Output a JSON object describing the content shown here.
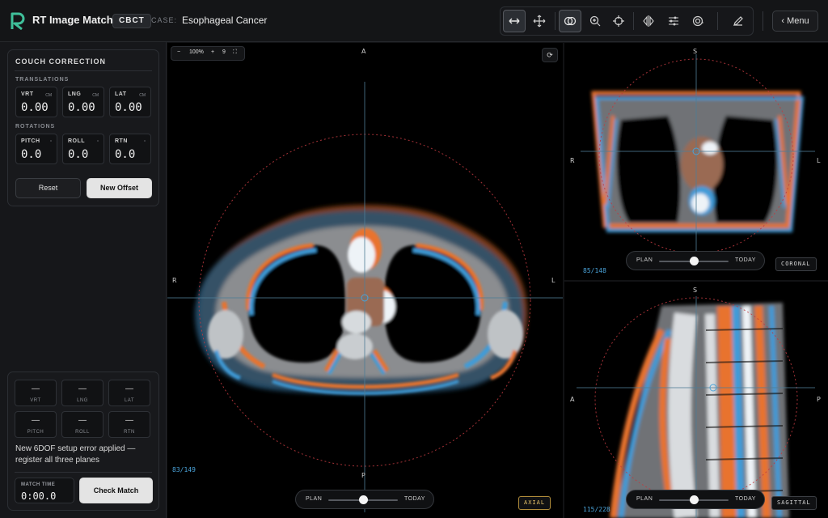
{
  "header": {
    "app_title": "RT Image Match",
    "modality_badge": "CBCT",
    "case_label": "CASE:",
    "case_name": "Esophageal Cancer",
    "menu_label": "‹ Menu",
    "tools": [
      {
        "name": "horizontal-move-icon",
        "active": true
      },
      {
        "name": "pan-icon",
        "active": false
      },
      {
        "name": "overlay-blend-icon",
        "active": true
      },
      {
        "name": "zoom-icon",
        "active": false
      },
      {
        "name": "crosshair-icon",
        "active": false
      },
      {
        "name": "flip-icon",
        "active": false
      },
      {
        "name": "window-level-icon",
        "active": false
      },
      {
        "name": "contour-icon",
        "active": false
      },
      {
        "name": "pen-icon",
        "active": false
      }
    ]
  },
  "couch": {
    "title": "COUCH CORRECTION",
    "translations_label": "TRANSLATIONS",
    "rotations_label": "ROTATIONS",
    "translations": [
      {
        "label": "VRT",
        "unit": "CM",
        "value": "0.00"
      },
      {
        "label": "LNG",
        "unit": "CM",
        "value": "0.00"
      },
      {
        "label": "LAT",
        "unit": "CM",
        "value": "0.00"
      }
    ],
    "rotations": [
      {
        "label": "PITCH",
        "unit": "°",
        "value": "0.0"
      },
      {
        "label": "ROLL",
        "unit": "°",
        "value": "0.0"
      },
      {
        "label": "RTN",
        "unit": "°",
        "value": "0.0"
      }
    ],
    "reset_label": "Reset",
    "new_offset_label": "New Offset"
  },
  "match": {
    "cells": [
      {
        "value": "—",
        "label": "VRT"
      },
      {
        "value": "—",
        "label": "LNG"
      },
      {
        "value": "—",
        "label": "LAT"
      },
      {
        "value": "—",
        "label": "PITCH"
      },
      {
        "value": "—",
        "label": "ROLL"
      },
      {
        "value": "—",
        "label": "RTN"
      }
    ],
    "message": "New 6DOF setup error applied — register all three planes",
    "time_label": "MATCH TIME",
    "time_value": "0:00.0",
    "check_label": "Check Match"
  },
  "axial": {
    "zoom_minus": "−",
    "zoom_value": "100%",
    "zoom_plus": "+",
    "zoom_extra": "9",
    "fit_glyph": "⛶",
    "reset_glyph": "⟳",
    "orient_top": "A",
    "orient_bottom": "P",
    "orient_left": "R",
    "orient_right": "L",
    "slice": "83/149",
    "plane_badge": "AXIAL",
    "blend": {
      "left": "PLAN",
      "right": "TODAY",
      "position": 0.5
    }
  },
  "coronal": {
    "orient_top": "S",
    "orient_left": "R",
    "orient_right": "L",
    "slice": "85/148",
    "plane_badge": "CORONAL",
    "blend": {
      "left": "PLAN",
      "right": "TODAY",
      "position": 0.5
    }
  },
  "sagittal": {
    "orient_top": "S",
    "orient_left": "A",
    "orient_right": "P",
    "slice": "115/228",
    "plane_badge": "SAGITTAL",
    "blend": {
      "left": "PLAN",
      "right": "TODAY",
      "position": 0.5
    }
  },
  "colors": {
    "plan": "#e8732d",
    "today": "#3f9bd8",
    "isocenter_ring": "#c0393f",
    "accent_gold": "#e6c36a"
  }
}
